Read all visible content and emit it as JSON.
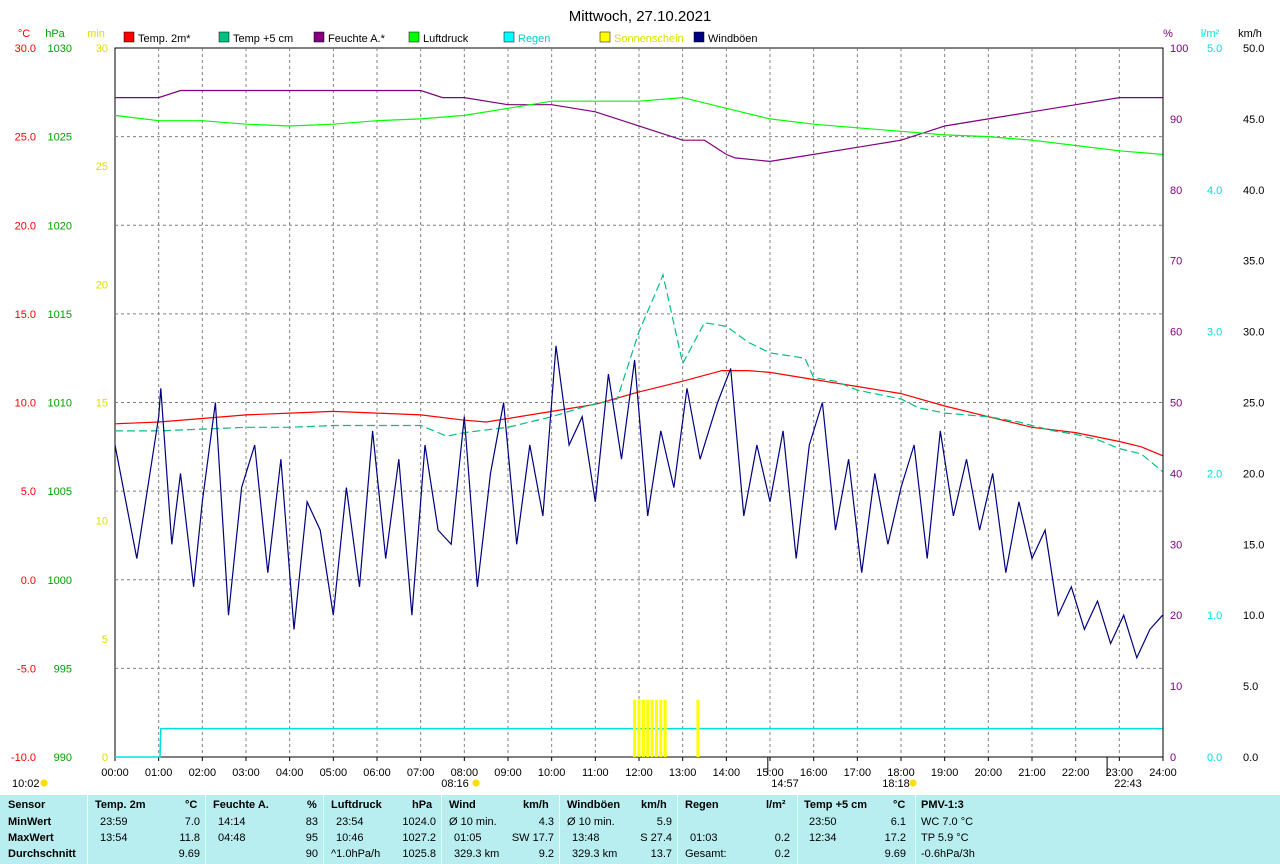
{
  "chart_data": {
    "type": "line",
    "title": "Mittwoch, 27.10.2021",
    "x_ticks": [
      "00:00",
      "01:00",
      "02:00",
      "03:00",
      "04:00",
      "05:00",
      "06:00",
      "07:00",
      "08:00",
      "09:00",
      "10:00",
      "11:00",
      "12:00",
      "13:00",
      "14:00",
      "15:00",
      "16:00",
      "17:00",
      "18:00",
      "19:00",
      "20:00",
      "21:00",
      "22:00",
      "23:00",
      "24:00"
    ],
    "grid": true,
    "axes": {
      "temp_c": {
        "unit": "°C",
        "min": -10,
        "max": 30,
        "ticks": [
          "30.0",
          "25.0",
          "20.0",
          "15.0",
          "10.0",
          "5.0",
          "0.0",
          "-5.0",
          "-10.0"
        ],
        "color": "#ff0000"
      },
      "pressure_hpa": {
        "unit": "hPa",
        "min": 990,
        "max": 1030,
        "ticks": [
          "1030",
          "1025",
          "1020",
          "1015",
          "1010",
          "1005",
          "1000",
          "995",
          "990"
        ],
        "color": "#00a000"
      },
      "sunshine_min": {
        "unit": "min",
        "min": 0,
        "max": 30,
        "ticks": [
          "30",
          "25",
          "20",
          "15",
          "10",
          "5",
          "0"
        ],
        "color": "#ffff00"
      },
      "humidity_pct": {
        "unit": "%",
        "min": 0,
        "max": 100,
        "ticks": [
          "100",
          "90",
          "80",
          "70",
          "60",
          "50",
          "40",
          "30",
          "20",
          "10",
          "0"
        ],
        "color": "#800080"
      },
      "rain_lm2": {
        "unit": "l/m²",
        "min": 0,
        "max": 5,
        "ticks": [
          "5.0",
          "4.0",
          "3.0",
          "2.0",
          "1.0",
          "0.0"
        ],
        "color": "#00e0e0"
      },
      "wind_kmh": {
        "unit": "km/h",
        "min": 0,
        "max": 50,
        "ticks": [
          "50.0",
          "45.0",
          "40.0",
          "35.0",
          "30.0",
          "25.0",
          "20.0",
          "15.0",
          "10.0",
          "5.0",
          "0.0"
        ],
        "color": "#000000"
      }
    },
    "legend": [
      {
        "name": "Temp. 2m*",
        "color": "#ff0000"
      },
      {
        "name": "Temp +5 cm",
        "color": "#00c080"
      },
      {
        "name": "Feuchte A.*",
        "color": "#800080"
      },
      {
        "name": "Luftdruck",
        "color": "#00ff00"
      },
      {
        "name": "Regen",
        "color": "#00ffff"
      },
      {
        "name": "Sonnenschein",
        "color": "#ffff00"
      },
      {
        "name": "Windböen",
        "color": "#000080"
      }
    ],
    "series": [
      {
        "name": "Temp. 2m*",
        "axis": "temp_c",
        "color": "#ff0000",
        "x": [
          0,
          1,
          2,
          3,
          4,
          5,
          6,
          7,
          8,
          8.5,
          9,
          10,
          11,
          12,
          13,
          13.9,
          14.5,
          15,
          16,
          17,
          18,
          19,
          20,
          21,
          22,
          23,
          23.5,
          23.99
        ],
        "y": [
          8.8,
          8.9,
          9.1,
          9.3,
          9.4,
          9.5,
          9.4,
          9.3,
          9.0,
          8.9,
          9.1,
          9.5,
          9.9,
          10.6,
          11.2,
          11.8,
          11.8,
          11.7,
          11.3,
          10.9,
          10.5,
          9.8,
          9.2,
          8.6,
          8.3,
          7.8,
          7.5,
          7.0
        ]
      },
      {
        "name": "Temp +5 cm",
        "axis": "temp_c",
        "color": "#00c080",
        "x": [
          0,
          1,
          2,
          3,
          4,
          5,
          6,
          7,
          7.6,
          8,
          9,
          10,
          10.8,
          11.5,
          12,
          12.4,
          12.55,
          13,
          13.5,
          14,
          14.5,
          15,
          15.8,
          16,
          16.5,
          17,
          18,
          18.4,
          19,
          20,
          20.7,
          21,
          21.5,
          22,
          22.5,
          23,
          23.5,
          23.99
        ],
        "y": [
          8.4,
          8.4,
          8.5,
          8.6,
          8.6,
          8.7,
          8.7,
          8.7,
          8.1,
          8.3,
          8.6,
          9.2,
          9.8,
          10.2,
          14.0,
          16.3,
          17.2,
          12.2,
          14.5,
          14.3,
          13.4,
          12.8,
          12.5,
          11.4,
          11.2,
          10.7,
          10.2,
          9.7,
          9.4,
          9.2,
          8.9,
          8.7,
          8.4,
          8.2,
          7.9,
          7.4,
          7.1,
          6.1
        ]
      },
      {
        "name": "Feuchte A.*",
        "axis": "humidity_pct",
        "color": "#800080",
        "x": [
          0,
          1,
          1.5,
          2,
          3,
          4,
          5,
          6,
          7,
          7.5,
          8,
          9,
          10,
          11,
          12,
          12.5,
          13,
          13.5,
          14,
          14.2,
          15,
          16,
          17,
          18,
          19,
          20,
          21,
          22,
          23,
          23.99
        ],
        "y": [
          93,
          93,
          94,
          94,
          94,
          94,
          94,
          94,
          94,
          93,
          93,
          92,
          92,
          91,
          89,
          88,
          87,
          87,
          85,
          84.5,
          84,
          85,
          86,
          87,
          89,
          90,
          91,
          92,
          93,
          93
        ]
      },
      {
        "name": "Luftdruck",
        "axis": "pressure_hpa",
        "color": "#00ff00",
        "x": [
          0,
          1,
          2,
          3,
          4,
          5,
          6,
          7,
          8,
          9,
          10,
          11,
          12,
          13,
          14,
          15,
          16,
          17,
          18,
          19,
          20,
          21,
          22,
          23,
          23.99
        ],
        "y": [
          1026.2,
          1025.9,
          1025.9,
          1025.7,
          1025.6,
          1025.7,
          1025.9,
          1026.0,
          1026.2,
          1026.6,
          1027.0,
          1027.0,
          1027.0,
          1027.2,
          1026.6,
          1026.0,
          1025.7,
          1025.5,
          1025.3,
          1025.1,
          1025.0,
          1024.8,
          1024.5,
          1024.2,
          1024.0
        ]
      },
      {
        "name": "Windböen",
        "axis": "wind_kmh",
        "color": "#000080",
        "x": [
          0,
          0.5,
          1.0,
          1.05,
          1.3,
          1.5,
          1.8,
          2,
          2.3,
          2.6,
          2.9,
          3.2,
          3.5,
          3.8,
          4.1,
          4.4,
          4.7,
          5,
          5.3,
          5.6,
          5.9,
          6.2,
          6.5,
          6.8,
          7.1,
          7.4,
          7.7,
          8,
          8.3,
          8.6,
          8.9,
          9.2,
          9.5,
          9.8,
          10.1,
          10.4,
          10.7,
          11,
          11.3,
          11.6,
          11.9,
          12.2,
          12.5,
          12.8,
          13.1,
          13.4,
          13.8,
          14.1,
          14.4,
          14.7,
          15,
          15.3,
          15.6,
          15.9,
          16.2,
          16.5,
          16.8,
          17.1,
          17.4,
          17.7,
          18,
          18.3,
          18.6,
          18.9,
          19.2,
          19.5,
          19.8,
          20.1,
          20.4,
          20.7,
          21,
          21.3,
          21.6,
          21.9,
          22.2,
          22.5,
          22.8,
          23.1,
          23.4,
          23.7,
          23.99
        ],
        "y": [
          22,
          14,
          24,
          26,
          15,
          20,
          12,
          18,
          25,
          10,
          19,
          22,
          13,
          21,
          9,
          18,
          16,
          10,
          19,
          12,
          23,
          14,
          21,
          10,
          22,
          16,
          15,
          24,
          12,
          20,
          25,
          15,
          22,
          17,
          29,
          22,
          24,
          18,
          27,
          21,
          28,
          17,
          23,
          19,
          26,
          21,
          25,
          27.4,
          17,
          22,
          18,
          23,
          14,
          22,
          25,
          16,
          21,
          13,
          20,
          15,
          19,
          22,
          14,
          23,
          17,
          21,
          16,
          20,
          13,
          18,
          14,
          16,
          10,
          12,
          9,
          11,
          8,
          10,
          7,
          9,
          10
        ]
      }
    ],
    "sunshine_markers": {
      "axis": "sunshine_min",
      "color": "#ffff00",
      "x": [
        11.9,
        12.0,
        12.1,
        12.2,
        12.3,
        12.4,
        12.5,
        12.6,
        13.35
      ],
      "y": [
        2,
        2,
        2,
        2,
        2,
        2,
        2,
        2,
        2
      ]
    },
    "rain_marker": {
      "axis": "rain_lm2",
      "color": "#00e0e0",
      "x": [
        0,
        1.03,
        1.05,
        23.99
      ],
      "y": [
        0,
        0,
        0.2,
        0.2
      ]
    },
    "bottom_annotations": {
      "left": "10:02",
      "sunrise": "08:16",
      "max_mark": "14:57",
      "sunset": "18:18",
      "min_mark": "22:43"
    }
  },
  "stats": {
    "labels": {
      "sensor": "Sensor",
      "min": "MinWert",
      "max": "MaxWert",
      "avg": "Durchschnitt"
    },
    "temp2m": {
      "header": "Temp. 2m",
      "unit": "°C",
      "min_time": "23:59",
      "min_val": "7.0",
      "max_time": "13:54",
      "max_val": "11.8",
      "avg_val": "9.69"
    },
    "humidity": {
      "header": "Feuchte A.",
      "unit": "%",
      "min_time": "14:14",
      "min_val": "83",
      "max_time": "04:48",
      "max_val": "95",
      "avg_val": "90"
    },
    "pressure": {
      "header": "Luftdruck",
      "unit": "hPa",
      "min_time": "23:54",
      "min_val": "1024.0",
      "max_time": "10:46",
      "max_val": "1027.2",
      "avg_label": "^1.0hPa/h",
      "avg_val": "1025.8"
    },
    "wind": {
      "header": "Wind",
      "unit": "km/h",
      "min_label": "Ø 10 min.",
      "min_val": "4.3",
      "max_time": "01:05",
      "max_val": "SW 17.7",
      "avg_label": "329.3 km",
      "avg_val": "9.2"
    },
    "gusts": {
      "header": "Windböen",
      "unit": "km/h",
      "min_label": "Ø 10 min.",
      "min_val": "5.9",
      "max_time": "13:48",
      "max_val": "S 27.4",
      "avg_label": "329.3 km",
      "avg_val": "13.7"
    },
    "rain": {
      "header": "Regen",
      "unit": "l/m²",
      "max_time": "01:03",
      "max_val": "0.2",
      "avg_label": "Gesamt:",
      "avg_val": "0.2"
    },
    "temp5cm": {
      "header": "Temp +5 cm",
      "unit": "°C",
      "min_time": "23:50",
      "min_val": "6.1",
      "max_time": "12:34",
      "max_val": "17.2",
      "avg_val": "9.69"
    },
    "pmv": {
      "header": "PMV-1:3",
      "min_label": "WC 7.0 °C",
      "max_label": "TP 5.9 °C",
      "avg_label": "-0.6hPa/3h"
    }
  }
}
